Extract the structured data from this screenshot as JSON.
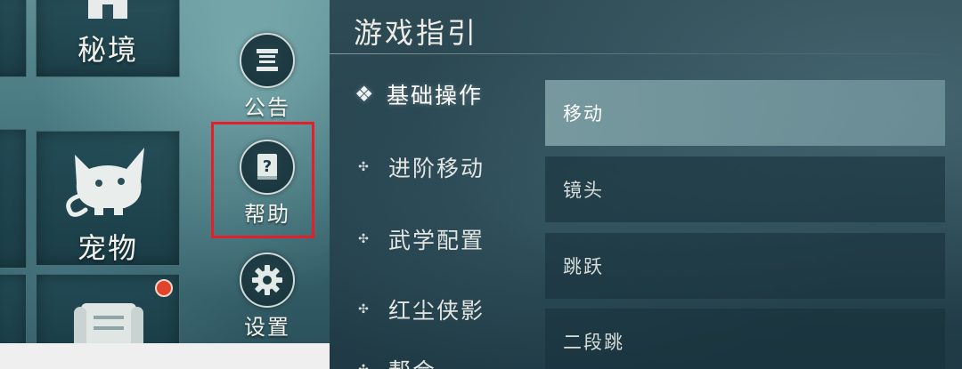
{
  "left_menu": {
    "tiles": {
      "secret": {
        "label": "秘境",
        "icon": "house-icon"
      },
      "pet": {
        "label": "宠物",
        "icon": "cat-icon"
      },
      "bottom": {
        "icon": "scroll-icon"
      }
    },
    "side_buttons": {
      "notice": {
        "label": "公告",
        "icon": "notice-board-icon"
      },
      "help": {
        "label": "帮助",
        "icon": "help-book-icon"
      },
      "settings": {
        "label": "设置",
        "icon": "gear-icon"
      }
    },
    "highlight_color": "#e3202a",
    "notification_color": "#e0442c"
  },
  "guide": {
    "title": "游戏指引",
    "categories": [
      {
        "label": "基础操作",
        "active": true
      },
      {
        "label": "进阶移动",
        "active": false
      },
      {
        "label": "武学配置",
        "active": false
      },
      {
        "label": "红尘侠影",
        "active": false
      },
      {
        "label": "帮会",
        "active": false
      }
    ],
    "sub_items": [
      {
        "label": "移动",
        "active": true
      },
      {
        "label": "镜头",
        "active": false
      },
      {
        "label": "跳跃",
        "active": false
      },
      {
        "label": "二段跳",
        "active": false
      }
    ]
  }
}
